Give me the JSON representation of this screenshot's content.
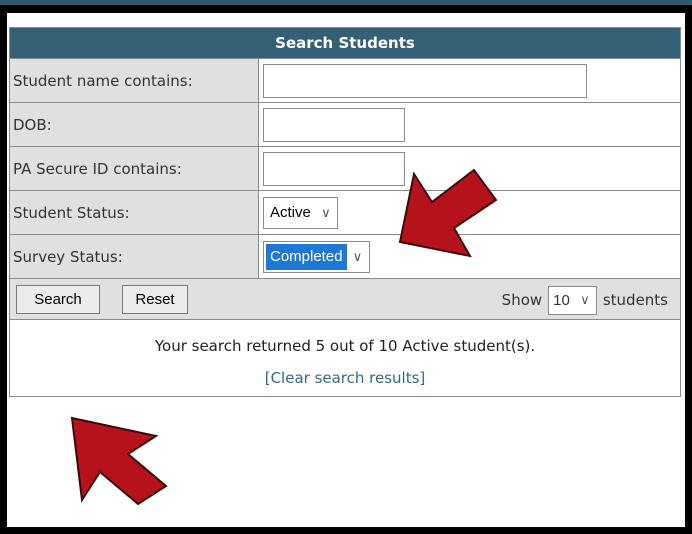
{
  "form": {
    "title": "Search Students",
    "fields": [
      {
        "label": "Student name contains:",
        "value": ""
      },
      {
        "label": "DOB:",
        "value": ""
      },
      {
        "label": "PA Secure ID contains:",
        "value": ""
      }
    ],
    "student_status": {
      "label": "Student Status:",
      "selected": "Active"
    },
    "survey_status": {
      "label": "Survey Status:",
      "selected": "Completed"
    },
    "buttons": {
      "search": "Search",
      "reset": "Reset"
    },
    "show": {
      "prefix": "Show",
      "value": "10",
      "suffix": "students"
    },
    "result_message": "Your search returned 5 out of 10 Active student(s).",
    "clear_link": "[Clear search results]"
  },
  "colors": {
    "header": "#346075",
    "label_bg": "#e0e0e0",
    "arrow": "#b5121b",
    "selected": "#1e78d6"
  },
  "icons": [
    "chevron-down-icon",
    "red-arrow-pointer"
  ]
}
